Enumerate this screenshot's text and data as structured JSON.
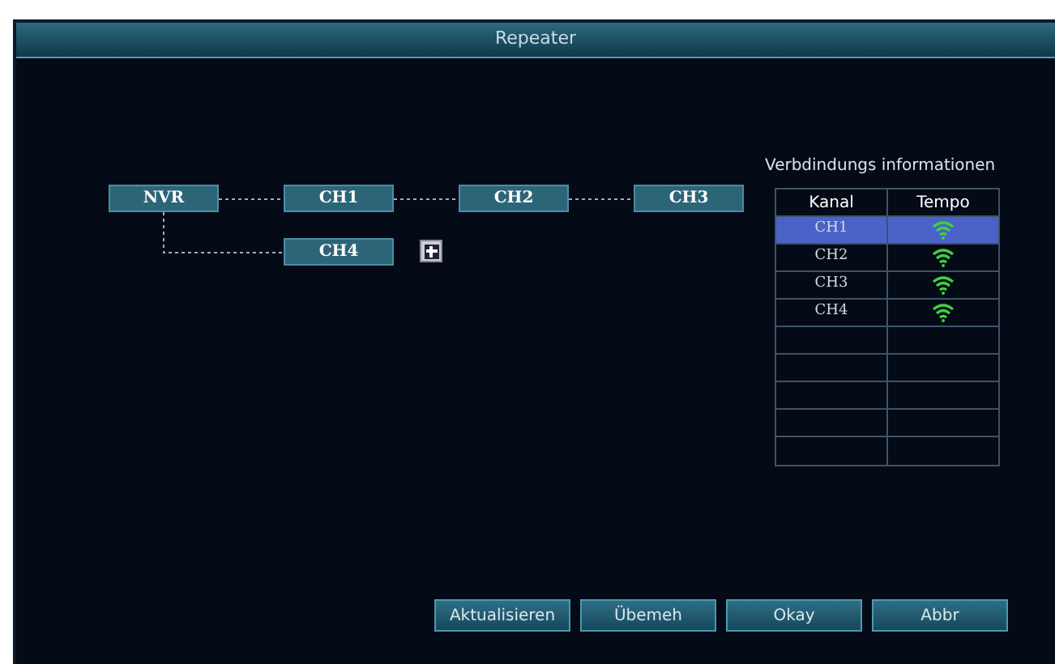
{
  "window": {
    "title": "Repeater"
  },
  "topology": {
    "nodes": [
      {
        "label": "NVR"
      },
      {
        "label": "CH1"
      },
      {
        "label": "CH2"
      },
      {
        "label": "CH3"
      },
      {
        "label": "CH4"
      }
    ]
  },
  "connection_info": {
    "title": "Verbdindungs informationen",
    "columns": [
      "Kanal",
      "Tempo"
    ],
    "rows": [
      {
        "channel": "CH1",
        "selected": true
      },
      {
        "channel": "CH2",
        "selected": false
      },
      {
        "channel": "CH3",
        "selected": false
      },
      {
        "channel": "CH4",
        "selected": false
      }
    ]
  },
  "buttons": [
    "Aktualisieren",
    "Übemeh",
    "Okay",
    "Abbr"
  ]
}
